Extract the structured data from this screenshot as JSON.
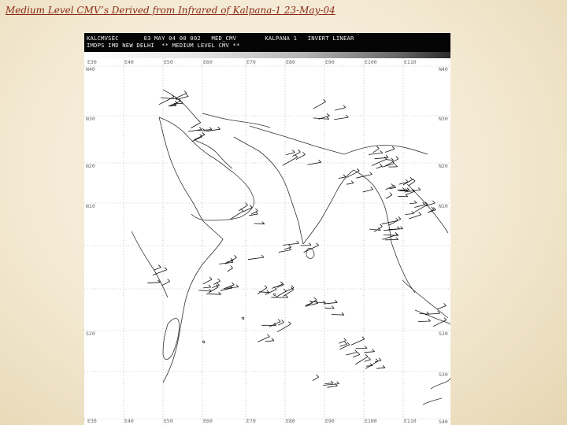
{
  "slide": {
    "title": "Medium Level CMV’s Derived from Infrared of Kalpana-1 23-May-04"
  },
  "imagery_header": {
    "line1": "KALCMVSEC       03 MAY 04 00 002   MED_CMV        KALPANA 1   INVERT LINEAR",
    "line2": "IMDPS IMD NEW DELHI  ** MEDIUM LEVEL CMV **"
  },
  "longitude_labels": [
    "E30",
    "E40",
    "E50",
    "E60",
    "E70",
    "E80",
    "E90",
    "E100",
    "E110"
  ],
  "longitude_labels_bottom": [
    "E30",
    "E40",
    "E50",
    "E60",
    "E70",
    "E80",
    "E90",
    "E100",
    "E110"
  ],
  "latitude_labels_left": [
    "N40",
    "N30",
    "N20",
    "N10",
    "",
    "",
    "S20",
    "",
    ""
  ],
  "latitude_labels_right": [
    "N40",
    "N30",
    "N20",
    "N10",
    "",
    "",
    "S20",
    "S30",
    "S40"
  ],
  "colors": {
    "title_text": "#8a2a14",
    "background": "#f3e9d2",
    "header_band": "#050505",
    "coastline": "#333333",
    "wind_vector": "#111111",
    "grid": "#9a9a9a"
  }
}
